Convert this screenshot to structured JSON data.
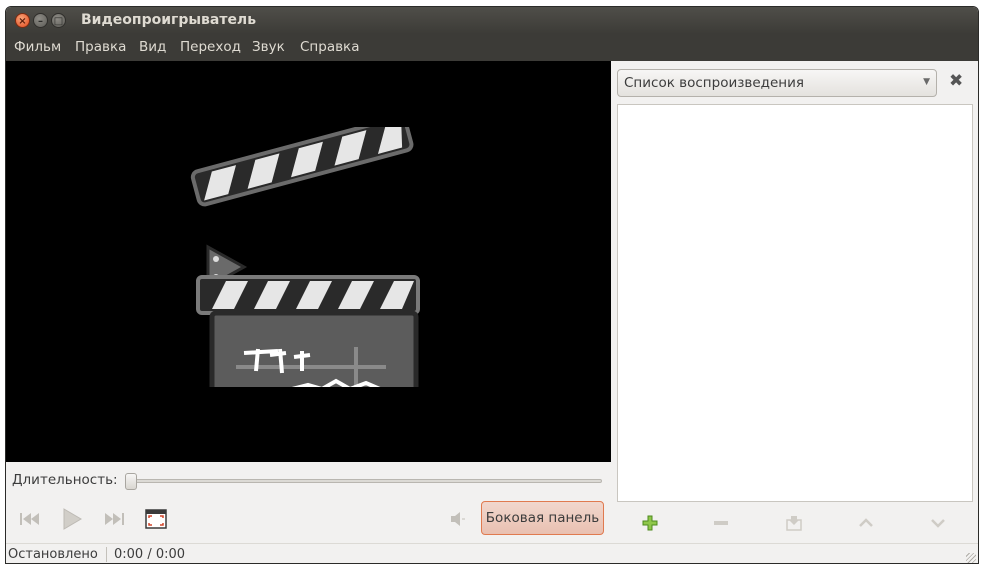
{
  "window": {
    "title": "Видеопроигрыватель",
    "close_glyph": "×",
    "minimize_glyph": "–",
    "maximize_glyph": "□"
  },
  "menu": [
    "Фильм",
    "Правка",
    "Вид",
    "Переход",
    "Звук",
    "Справка"
  ],
  "video": {
    "placeholder_icon": "clapperboard-icon",
    "background": "#000000"
  },
  "controls": {
    "duration_label": "Длительность:",
    "seek_position": 0,
    "buttons": [
      "previous-icon",
      "play-icon",
      "next-icon",
      "fullscreen-icon",
      "volume-icon"
    ],
    "sidebar_button": "Боковая панель"
  },
  "sidebar": {
    "selected_panel": "Список воспроизведения",
    "close_glyph": "✖",
    "playlist_items": [],
    "playlist_buttons": [
      "add-icon",
      "remove-icon",
      "save-icon",
      "move-up-icon",
      "move-down-icon"
    ]
  },
  "status": {
    "state": "Остановлено",
    "time": "0:00 / 0:00"
  },
  "colors": {
    "titlebar": "#3c3b37",
    "accent": "#e07a4f",
    "close_button": "#e2491c"
  }
}
